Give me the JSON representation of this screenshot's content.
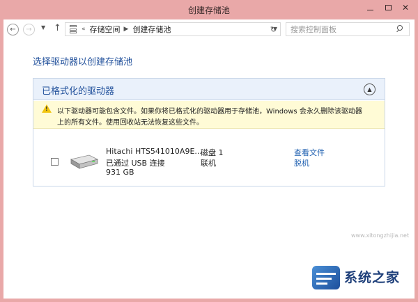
{
  "window": {
    "title": "创建存储池"
  },
  "nav": {
    "breadcrumb_prefix": "«",
    "breadcrumbs": [
      "存储空间",
      "创建存储池"
    ],
    "search_placeholder": "搜索控制面板"
  },
  "page": {
    "title": "选择驱动器以创建存储池"
  },
  "panel": {
    "title": "已格式化的驱动器",
    "warning_line1": "以下驱动器可能包含文件。如果你将已格式化的驱动器用于存储池，Windows 会永久删除该驱动器",
    "warning_line2": "上的所有文件。使用回收站无法恢复这些文件。"
  },
  "drive": {
    "name": "Hitachi HTS541010A9E...",
    "connection": "已通过 USB 连接",
    "size": "931 GB",
    "disk": "磁盘 1",
    "status": "联机",
    "link_view": "查看文件",
    "link_offline": "脱机",
    "checked": false
  },
  "watermark": {
    "name": "系统之家",
    "url": "XITONGZHIJIA.NET",
    "small": "www.xitongzhijia.net"
  },
  "colors": {
    "accent": "#1e4e9a",
    "titlebar": "#e9a8a8",
    "warning_bg": "#fffbd6",
    "link": "#1e5fb0"
  }
}
